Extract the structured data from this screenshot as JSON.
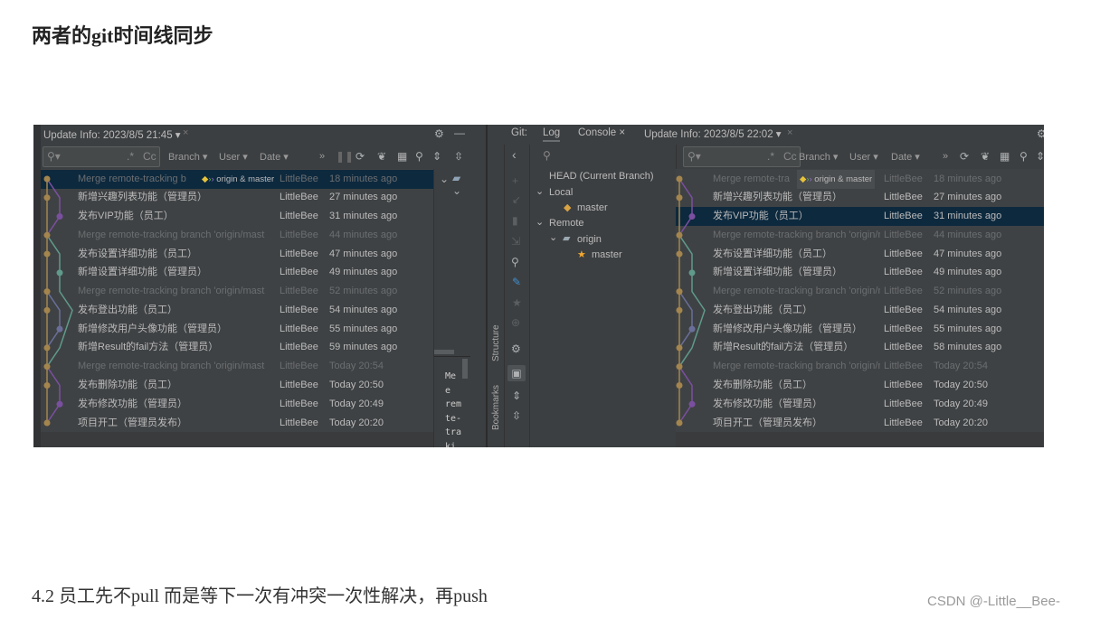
{
  "article": {
    "heading": "两者的git时间线同步",
    "paragraph": "4.2  员工先不pull  而是等下一次有冲突一次性解决，再push",
    "watermark": "CSDN @-Little__Bee-"
  },
  "colors": {
    "accent_selected": "#0d293e",
    "graph_main": "#a4854d",
    "graph_purple": "#7b4fa0",
    "graph_teal": "#5f9a8a",
    "graph_slate": "#6a6f9a",
    "tag_yellow": "#e8c33a",
    "tag_green": "#6ab04c",
    "tag_purple": "#9b6dd6"
  },
  "left_panel": {
    "title": "Update Info: 2023/8/5 21:45 ▾",
    "close": "×",
    "filters": {
      "branch": "Branch ▾",
      "user": "User ▾",
      "date": "Date ▾",
      "more": "»",
      "regex": ".*",
      "case": "Cc"
    },
    "selected_row": 0,
    "details_text": [
      "Me",
      "e",
      "rem",
      "te-",
      "tra",
      "ki"
    ],
    "commit_times": [
      "18 minutes ago",
      "27 minutes ago",
      "31 minutes ago",
      "44 minutes ago",
      "47 minutes ago",
      "49 minutes ago",
      "52 minutes ago",
      "54 minutes ago",
      "55 minutes ago",
      "59 minutes ago",
      "Today 20:54",
      "Today 20:50",
      "Today 20:49",
      "Today 20:20"
    ],
    "first_message": "Merge remote-tracking b"
  },
  "right_panel": {
    "git_label": "Git:",
    "tabs": [
      {
        "label": "Log",
        "active": true
      },
      {
        "label": "Console ×",
        "active": false
      }
    ],
    "title": "Update Info: 2023/8/5 22:02 ▾",
    "close": "×",
    "filters": {
      "branch": "Branch ▾",
      "user": "User ▾",
      "date": "Date ▾",
      "more": "»",
      "regex": ".*",
      "case": "Cc"
    },
    "selected_row": 2,
    "side_labels": {
      "structure": "Structure",
      "bookmarks": "Bookmarks"
    },
    "branches": {
      "head": "HEAD (Current Branch)",
      "local": "Local",
      "local_master": "master",
      "remote": "Remote",
      "origin": "origin",
      "origin_master": "master"
    },
    "commit_times": [
      "18 minutes ago",
      "27 minutes ago",
      "31 minutes ago",
      "44 minutes ago",
      "47 minutes ago",
      "49 minutes ago",
      "52 minutes ago",
      "54 minutes ago",
      "55 minutes ago",
      "58 minutes ago",
      "Today 20:54",
      "Today 20:50",
      "Today 20:49",
      "Today 20:20"
    ],
    "first_message": "Merge remote-tra"
  },
  "ref_tag": "origin & master",
  "commits": [
    {
      "message": "Merge remote-tracking branch 'origin/mast",
      "author": "LittleBee",
      "merge": true,
      "lane": 0
    },
    {
      "message": "新增兴趣列表功能（管理员）",
      "author": "LittleBee",
      "merge": false,
      "lane": 0
    },
    {
      "message": "发布VIP功能（员工）",
      "author": "LittleBee",
      "merge": false,
      "lane": 1
    },
    {
      "message": "Merge remote-tracking branch 'origin/mast",
      "author": "LittleBee",
      "merge": true,
      "lane": 0
    },
    {
      "message": "发布设置详细功能（员工）",
      "author": "LittleBee",
      "merge": false,
      "lane": 0
    },
    {
      "message": "新增设置详细功能（管理员）",
      "author": "LittleBee",
      "merge": false,
      "lane": 1
    },
    {
      "message": "Merge remote-tracking branch 'origin/mast",
      "author": "LittleBee",
      "merge": true,
      "lane": 0
    },
    {
      "message": "发布登出功能（员工）",
      "author": "LittleBee",
      "merge": false,
      "lane": 0
    },
    {
      "message": "新增修改用户头像功能（管理员）",
      "author": "LittleBee",
      "merge": false,
      "lane": 1
    },
    {
      "message": "新增Result的fail方法（管理员）",
      "author": "LittleBee",
      "merge": false,
      "lane": 0
    },
    {
      "message": "Merge remote-tracking branch 'origin/mast",
      "author": "LittleBee",
      "merge": true,
      "lane": 0
    },
    {
      "message": "发布删除功能（员工）",
      "author": "LittleBee",
      "merge": false,
      "lane": 0
    },
    {
      "message": "发布修改功能（管理员）",
      "author": "LittleBee",
      "merge": false,
      "lane": 1
    },
    {
      "message": "项目开工（管理员发布）",
      "author": "LittleBee",
      "merge": false,
      "lane": 0
    }
  ]
}
